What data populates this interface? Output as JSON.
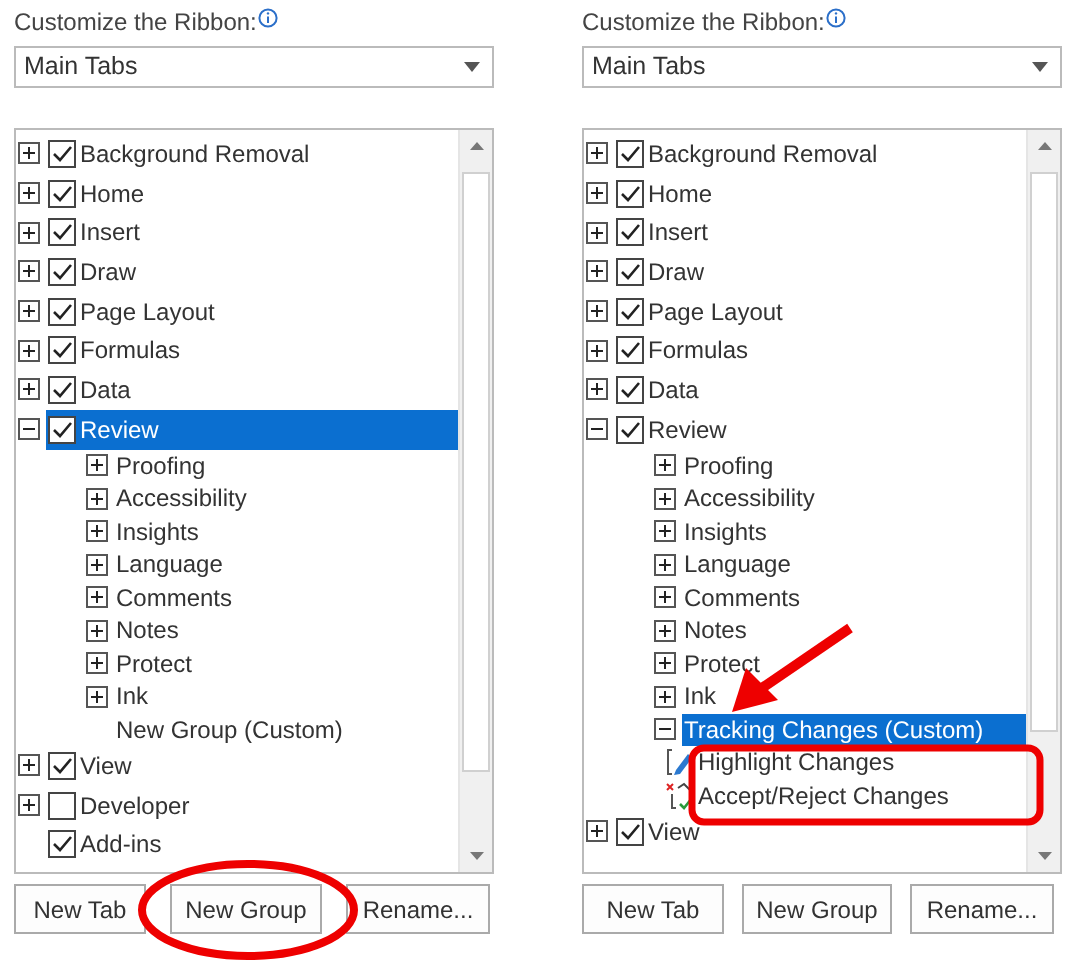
{
  "panels": [
    {
      "label": "Customize the Ribbon:",
      "dropdown": "Main Tabs",
      "tree": [
        {
          "kind": "tab",
          "label": "Background Removal",
          "checked": true,
          "expanded": false,
          "selected": false
        },
        {
          "kind": "tab",
          "label": "Home",
          "checked": true,
          "expanded": false,
          "selected": false
        },
        {
          "kind": "tab",
          "label": "Insert",
          "checked": true,
          "expanded": false,
          "selected": false
        },
        {
          "kind": "tab",
          "label": "Draw",
          "checked": true,
          "expanded": false,
          "selected": false
        },
        {
          "kind": "tab",
          "label": "Page Layout",
          "checked": true,
          "expanded": false,
          "selected": false
        },
        {
          "kind": "tab",
          "label": "Formulas",
          "checked": true,
          "expanded": false,
          "selected": false
        },
        {
          "kind": "tab",
          "label": "Data",
          "checked": true,
          "expanded": false,
          "selected": false
        },
        {
          "kind": "tab",
          "label": "Review",
          "checked": true,
          "expanded": true,
          "selected": true,
          "children": [
            {
              "kind": "group",
              "label": "Proofing",
              "expanded": false,
              "selected": false
            },
            {
              "kind": "group",
              "label": "Accessibility",
              "expanded": false,
              "selected": false
            },
            {
              "kind": "group",
              "label": "Insights",
              "expanded": false,
              "selected": false
            },
            {
              "kind": "group",
              "label": "Language",
              "expanded": false,
              "selected": false
            },
            {
              "kind": "group",
              "label": "Comments",
              "expanded": false,
              "selected": false
            },
            {
              "kind": "group",
              "label": "Notes",
              "expanded": false,
              "selected": false
            },
            {
              "kind": "group",
              "label": "Protect",
              "expanded": false,
              "selected": false
            },
            {
              "kind": "group",
              "label": "Ink",
              "expanded": false,
              "selected": false
            },
            {
              "kind": "group",
              "label": "New Group (Custom)",
              "selected": false
            }
          ]
        },
        {
          "kind": "tab",
          "label": "View",
          "checked": true,
          "expanded": false,
          "selected": false
        },
        {
          "kind": "tab",
          "label": "Developer",
          "checked": false,
          "expanded": false,
          "selected": false
        },
        {
          "kind": "tab",
          "label": "Add-ins",
          "checked": true,
          "selected": false
        }
      ],
      "buttons": [
        "New Tab",
        "New Group",
        "Rename..."
      ]
    },
    {
      "label": "Customize the Ribbon:",
      "dropdown": "Main Tabs",
      "tree": [
        {
          "kind": "tab",
          "label": "Background Removal",
          "checked": true,
          "expanded": false,
          "selected": false
        },
        {
          "kind": "tab",
          "label": "Home",
          "checked": true,
          "expanded": false,
          "selected": false
        },
        {
          "kind": "tab",
          "label": "Insert",
          "checked": true,
          "expanded": false,
          "selected": false
        },
        {
          "kind": "tab",
          "label": "Draw",
          "checked": true,
          "expanded": false,
          "selected": false
        },
        {
          "kind": "tab",
          "label": "Page Layout",
          "checked": true,
          "expanded": false,
          "selected": false
        },
        {
          "kind": "tab",
          "label": "Formulas",
          "checked": true,
          "expanded": false,
          "selected": false
        },
        {
          "kind": "tab",
          "label": "Data",
          "checked": true,
          "expanded": false,
          "selected": false
        },
        {
          "kind": "tab",
          "label": "Review",
          "checked": true,
          "expanded": true,
          "selected": false,
          "children": [
            {
              "kind": "group",
              "label": "Proofing",
              "expanded": false,
              "selected": false
            },
            {
              "kind": "group",
              "label": "Accessibility",
              "expanded": false,
              "selected": false
            },
            {
              "kind": "group",
              "label": "Insights",
              "expanded": false,
              "selected": false
            },
            {
              "kind": "group",
              "label": "Language",
              "expanded": false,
              "selected": false
            },
            {
              "kind": "group",
              "label": "Comments",
              "expanded": false,
              "selected": false
            },
            {
              "kind": "group",
              "label": "Notes",
              "expanded": false,
              "selected": false
            },
            {
              "kind": "group",
              "label": "Protect",
              "expanded": false,
              "selected": false
            },
            {
              "kind": "group",
              "label": "Ink",
              "expanded": false,
              "selected": false
            },
            {
              "kind": "group",
              "label": "Tracking Changes (Custom)",
              "expanded": true,
              "selected": true,
              "children": [
                {
                  "kind": "command",
                  "label": "Highlight Changes",
                  "selected": false
                },
                {
                  "kind": "command",
                  "label": "Accept/Reject Changes",
                  "selected": false
                }
              ]
            }
          ]
        },
        {
          "kind": "tab",
          "label": "View",
          "checked": true,
          "expanded": false,
          "selected": false
        }
      ],
      "buttons": [
        "New Tab",
        "New Group",
        "Rename..."
      ]
    }
  ]
}
